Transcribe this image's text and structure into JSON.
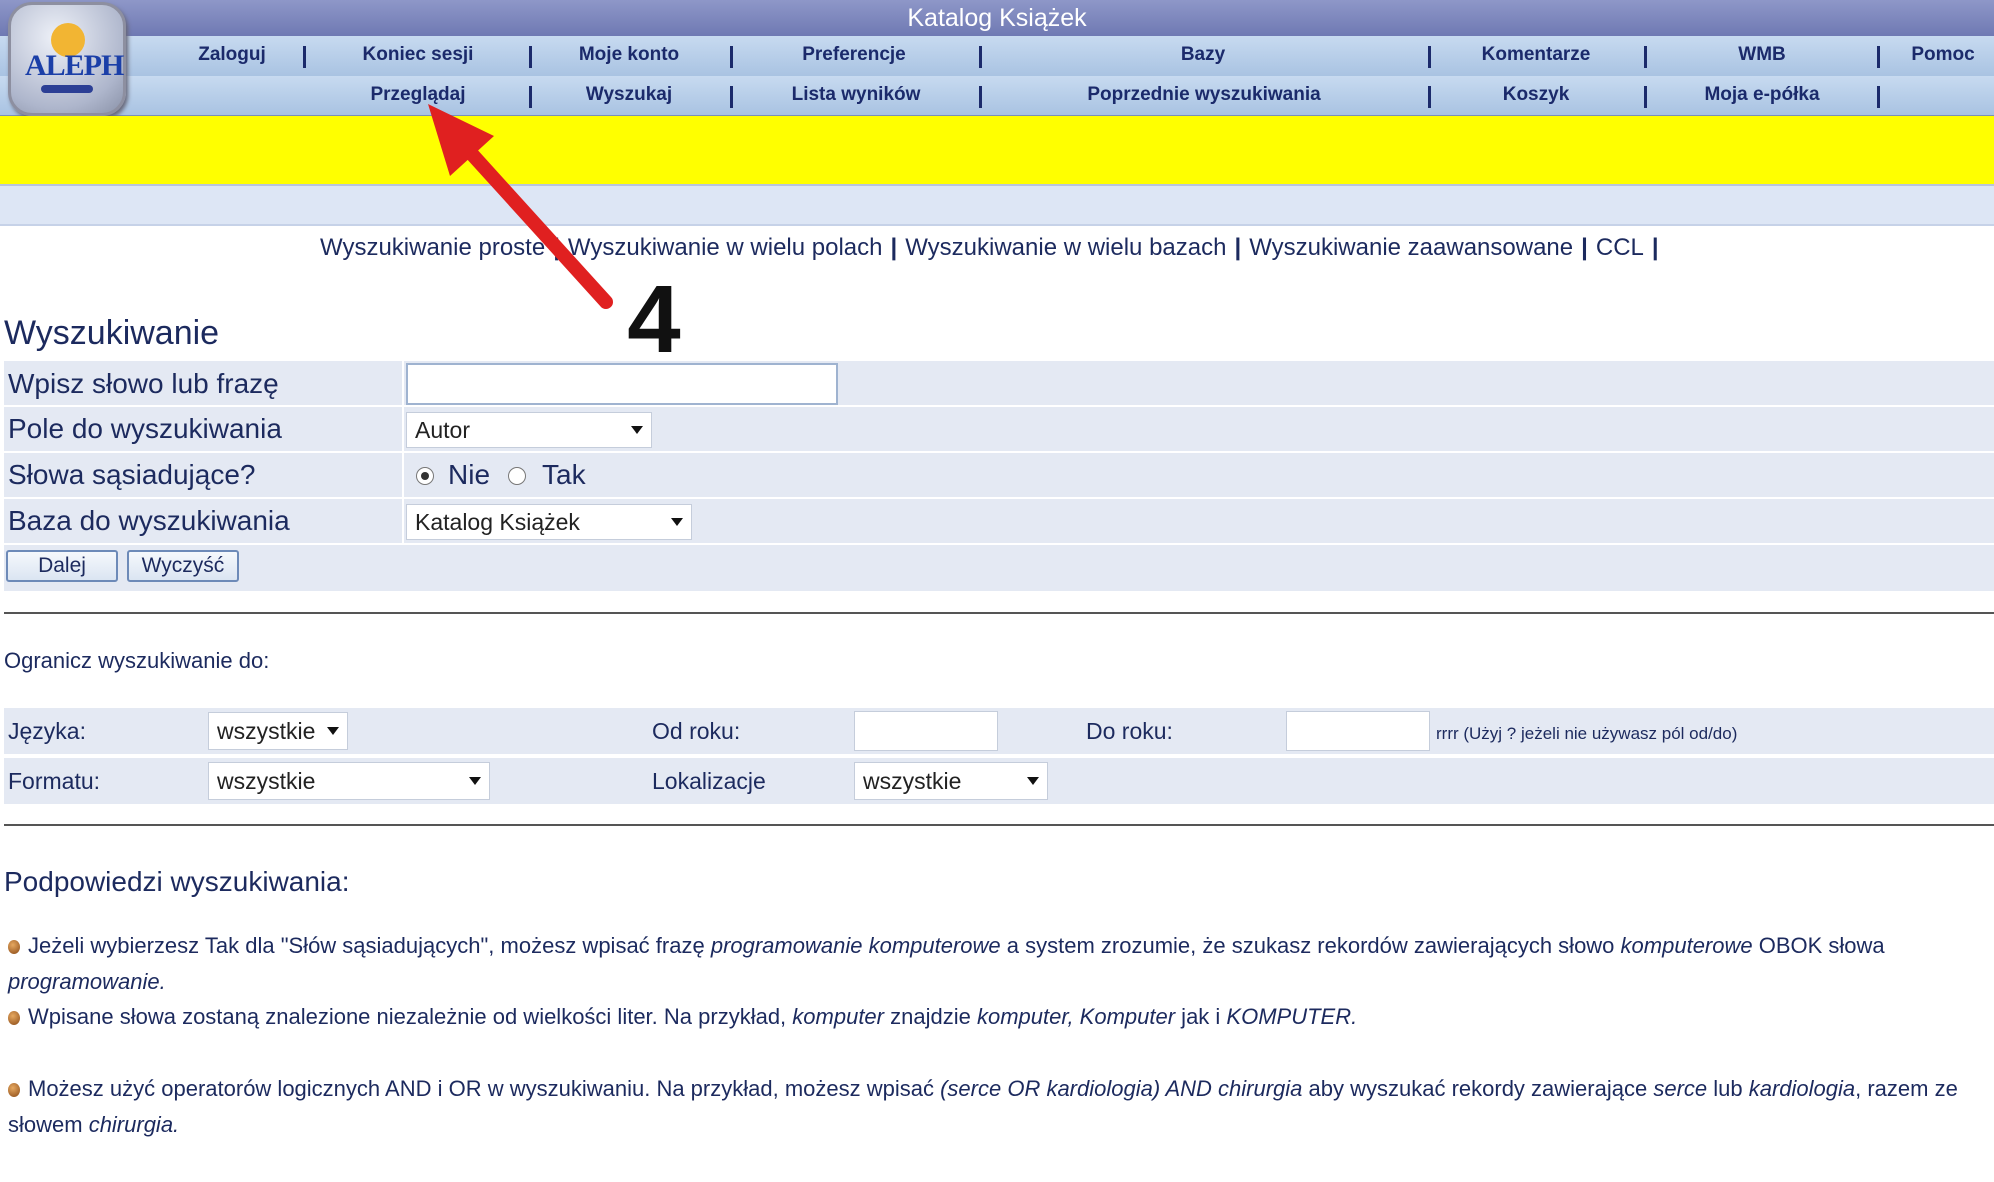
{
  "header": {
    "title": "Katalog Książek",
    "logo_text": "ALEPH",
    "nav_row1": [
      "Zaloguj",
      "Koniec sesji",
      "Moje konto",
      "Preferencje",
      "Bazy",
      "Komentarze",
      "WMB",
      "Pomoc"
    ],
    "nav_row2": [
      "Przeglądaj",
      "Wyszukaj",
      "Lista wyników",
      "Poprzednie wyszukiwania",
      "Koszyk",
      "Moja e-półka"
    ]
  },
  "search_tabs": [
    "Wyszukiwanie proste",
    "Wyszukiwanie w wielu polach",
    "Wyszukiwanie w wielu bazach",
    "Wyszukiwanie zaawansowane",
    "CCL"
  ],
  "annotation": {
    "number": "4",
    "color": "#e02020"
  },
  "search": {
    "heading": "Wyszukiwanie",
    "phrase_label": "Wpisz słowo lub frazę",
    "phrase_value": "",
    "field_label": "Pole do wyszukiwania",
    "field_value": "Autor",
    "adjacent_label": "Słowa sąsiadujące?",
    "adjacent_no": "Nie",
    "adjacent_yes": "Tak",
    "base_label": "Baza do wyszukiwania",
    "base_value": "Katalog Książek",
    "submit_label": "Dalej",
    "clear_label": "Wyczyść"
  },
  "limits": {
    "title": "Ogranicz wyszukiwanie do:",
    "language_label": "Języka:",
    "language_value": "wszystkie",
    "from_year_label": "Od roku:",
    "from_year_value": "",
    "to_year_label": "Do roku:",
    "to_year_value": "",
    "year_hint": "rrrr (Użyj ? jeżeli nie używasz pól od/do)",
    "format_label": "Formatu:",
    "format_value": "wszystkie",
    "location_label": "Lokalizacje",
    "location_value": "wszystkie"
  },
  "tips": {
    "title": "Podpowiedzi wyszukiwania:",
    "tip1": {
      "a": "Jeżeli wybierzesz Tak dla \"Słów sąsiadujących\", możesz wpisać frazę ",
      "b": "programowanie komputerowe",
      "c": " a system zrozumie, że szukasz rekordów zawierających słowo ",
      "d": "komputerowe",
      "e": " OBOK słowa ",
      "f": "programowanie."
    },
    "tip2": {
      "a": "Wpisane słowa zostaną znalezione niezależnie od wielkości liter. Na przykład, ",
      "b": "komputer",
      "c": " znajdzie ",
      "d": "komputer, Komputer",
      "e": " jak i ",
      "f": "KOMPUTER."
    },
    "tip3": {
      "a": "Możesz użyć operatorów logicznych AND i OR w wyszukiwaniu. Na przykład, możesz wpisać ",
      "b": "(serce OR kardiologia) AND chirurgia",
      "c": " aby wyszukać rekordy zawierające ",
      "d": "serce",
      "e": " lub ",
      "f": "kardiologia",
      "g": ", razem ze słowem ",
      "h": "chirurgia."
    }
  }
}
